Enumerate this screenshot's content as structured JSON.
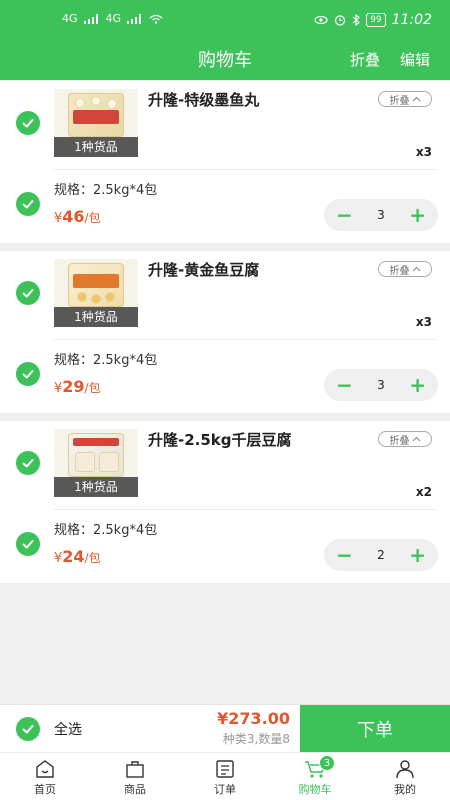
{
  "status_bar": {
    "network_left": "4G",
    "network_right": "4G",
    "battery": "99",
    "time": "11:02"
  },
  "header": {
    "title": "购物车",
    "fold_label": "折叠",
    "edit_label": "编辑"
  },
  "items": [
    {
      "name": "升隆-特级墨鱼丸",
      "caption": "1种货品",
      "fold": "折叠",
      "qty_label": "x3",
      "spec": "规格：2.5kg*4包",
      "price_symbol": "¥",
      "price": "46",
      "unit": "/包",
      "qty": "3"
    },
    {
      "name": "升隆-黄金鱼豆腐",
      "caption": "1种货品",
      "fold": "折叠",
      "qty_label": "x3",
      "spec": "规格：2.5kg*4包",
      "price_symbol": "¥",
      "price": "29",
      "unit": "/包",
      "qty": "3"
    },
    {
      "name": "升隆-2.5kg千层豆腐",
      "caption": "1种货品",
      "fold": "折叠",
      "qty_label": "x2",
      "spec": "规格：2.5kg*4包",
      "price_symbol": "¥",
      "price": "24",
      "unit": "/包",
      "qty": "2"
    }
  ],
  "footer": {
    "select_all": "全选",
    "total": "¥273.00",
    "summary": "种类3,数量8",
    "order_button": "下单"
  },
  "tabs": [
    {
      "label": "首页",
      "icon": "home-icon"
    },
    {
      "label": "商品",
      "icon": "bag-icon"
    },
    {
      "label": "订单",
      "icon": "order-icon"
    },
    {
      "label": "购物车",
      "icon": "cart-icon",
      "badge": "3"
    },
    {
      "label": "我的",
      "icon": "user-icon"
    }
  ],
  "colors": {
    "accent": "#3dc25a",
    "price": "#e2572b",
    "background": "#efefef"
  }
}
